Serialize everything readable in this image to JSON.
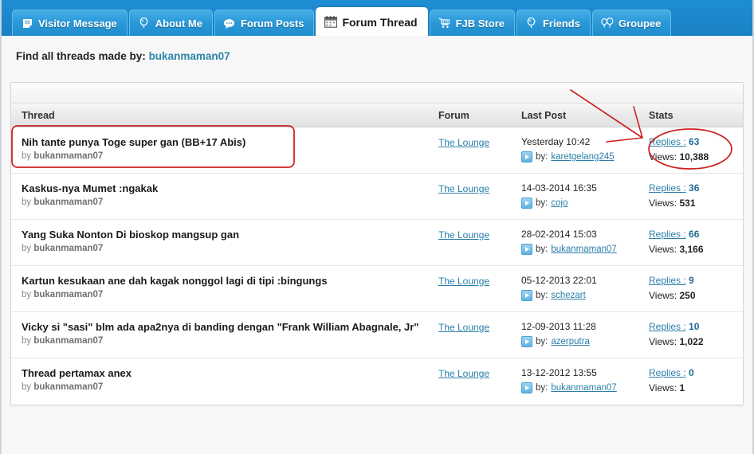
{
  "tabs": [
    {
      "label": "Visitor Message",
      "icon": "note-icon",
      "active": false
    },
    {
      "label": "About Me",
      "icon": "balloon-icon",
      "active": false
    },
    {
      "label": "Forum Posts",
      "icon": "speech-bubble-icon",
      "active": false
    },
    {
      "label": "Forum Thread",
      "icon": "calendar-icon",
      "active": true
    },
    {
      "label": "FJB Store",
      "icon": "shopping-cart-icon",
      "active": false
    },
    {
      "label": "Friends",
      "icon": "balloon-icon",
      "active": false
    },
    {
      "label": "Groupee",
      "icon": "two-balloons-icon",
      "active": false
    }
  ],
  "header": {
    "find_prefix": "Find all threads made by:",
    "username": "bukanmaman07"
  },
  "table": {
    "columns": {
      "thread": "Thread",
      "forum": "Forum",
      "last_post": "Last Post",
      "stats": "Stats"
    },
    "rows": [
      {
        "title": "Nih tante punya Toge super gan (BB+17 Abis)",
        "by_prefix": "by",
        "author": "bukanmaman07",
        "forum": "The Lounge",
        "last_date": "Yesterday 10:42",
        "last_by_prefix": "by:",
        "last_by_user": "karetgelang245",
        "replies_label": "Replies :",
        "replies_count": "63",
        "views_label": "Views:",
        "views_count": "10,388",
        "highlighted": true
      },
      {
        "title": "Kaskus-nya Mumet :ngakak",
        "by_prefix": "by",
        "author": "bukanmaman07",
        "forum": "The Lounge",
        "last_date": "14-03-2014 16:35",
        "last_by_prefix": "by:",
        "last_by_user": "cojo",
        "replies_label": "Replies :",
        "replies_count": "36",
        "views_label": "Views:",
        "views_count": "531",
        "highlighted": false
      },
      {
        "title": "Yang Suka Nonton Di bioskop mangsup gan",
        "by_prefix": "by",
        "author": "bukanmaman07",
        "forum": "The Lounge",
        "last_date": "28-02-2014 15:03",
        "last_by_prefix": "by:",
        "last_by_user": "bukanmaman07",
        "replies_label": "Replies :",
        "replies_count": "66",
        "views_label": "Views:",
        "views_count": "3,166",
        "highlighted": false
      },
      {
        "title": "Kartun kesukaan ane dah kagak nonggol lagi di tipi :bingungs",
        "by_prefix": "by",
        "author": "bukanmaman07",
        "forum": "The Lounge",
        "last_date": "05-12-2013 22:01",
        "last_by_prefix": "by:",
        "last_by_user": "schezart",
        "replies_label": "Replies :",
        "replies_count": "9",
        "views_label": "Views:",
        "views_count": "250",
        "highlighted": false
      },
      {
        "title": "Vicky si \"sasi\" blm ada apa2nya di banding dengan \"Frank William Abagnale, Jr\"",
        "by_prefix": "by",
        "author": "bukanmaman07",
        "forum": "The Lounge",
        "last_date": "12-09-2013 11:28",
        "last_by_prefix": "by:",
        "last_by_user": "azerputra",
        "replies_label": "Replies :",
        "replies_count": "10",
        "views_label": "Views:",
        "views_count": "1,022",
        "highlighted": false
      },
      {
        "title": "Thread pertamax anex",
        "by_prefix": "by",
        "author": "bukanmaman07",
        "forum": "The Lounge",
        "last_date": "13-12-2012 13:55",
        "last_by_prefix": "by:",
        "last_by_user": "bukanmaman07",
        "replies_label": "Replies :",
        "replies_count": "0",
        "views_label": "Views:",
        "views_count": "1",
        "highlighted": false
      }
    ]
  },
  "annotations": {
    "color": "#cc2222",
    "shapes": [
      "highlight-rectangle-first-thread",
      "arrow-to-stats",
      "ellipse-around-stats"
    ]
  },
  "colors": {
    "tabbar_blue": "#1f8fd6",
    "link_blue": "#2a7fa8",
    "annotation_red": "#cc2222",
    "panel_bg": "#ffffff",
    "page_bg": "#f7f7f7"
  }
}
